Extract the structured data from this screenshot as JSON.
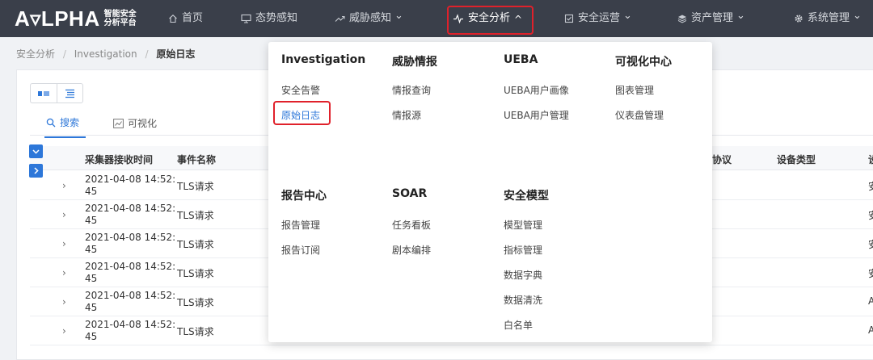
{
  "app": {
    "logo_text": "A▿LPHA",
    "logo_sub_1": "智能安全",
    "logo_sub_2": "分析平台"
  },
  "topnav": {
    "items": [
      {
        "label": "首页",
        "icon": "home-icon"
      },
      {
        "label": "态势感知",
        "icon": "monitor-icon"
      },
      {
        "label": "威胁感知",
        "icon": "trend-icon",
        "chevron": "down"
      },
      {
        "label": "安全分析",
        "icon": "pulse-icon",
        "chevron": "up",
        "active": true
      },
      {
        "label": "安全运营",
        "icon": "checkbox-icon",
        "chevron": "down"
      },
      {
        "label": "资产管理",
        "icon": "layers-icon",
        "chevron": "down"
      },
      {
        "label": "系统管理",
        "icon": "gear-icon",
        "chevron": "down"
      }
    ],
    "chev_down": "⌄",
    "chev_up": "^"
  },
  "breadcrumb": {
    "items": [
      "安全分析",
      "Investigation",
      "原始日志"
    ],
    "separator": "/"
  },
  "tabs": [
    {
      "label": "搜索",
      "active": true
    },
    {
      "label": "可视化",
      "active": false
    }
  ],
  "table": {
    "columns": [
      "采集器接收时间",
      "事件名称",
      "协议",
      "设备类型",
      "设"
    ],
    "rows": [
      {
        "time_line1": "2021-04-08 14:52:",
        "time_line2": "45",
        "event": "TLS请求",
        "right": "安"
      },
      {
        "time_line1": "2021-04-08 14:52:",
        "time_line2": "45",
        "event": "TLS请求",
        "right": "安"
      },
      {
        "time_line1": "2021-04-08 14:52:",
        "time_line2": "45",
        "event": "TLS请求",
        "right": "安"
      },
      {
        "time_line1": "2021-04-08 14:52:",
        "time_line2": "45",
        "event": "TLS请求",
        "right": "安"
      },
      {
        "time_line1": "2021-04-08 14:52:",
        "time_line2": "45",
        "event": "TLS请求",
        "right": "A"
      },
      {
        "time_line1": "2021-04-08 14:52:",
        "time_line2": "45",
        "event": "TLS请求",
        "right": "A"
      }
    ],
    "expand_chevron": "›"
  },
  "dropdown": {
    "sections": [
      {
        "title": "Investigation",
        "items": [
          "安全告警",
          "原始日志"
        ],
        "selected": "原始日志"
      },
      {
        "title": "威胁情报",
        "items": [
          "情报查询",
          "情报源"
        ]
      },
      {
        "title": "UEBA",
        "items": [
          "UEBA用户画像",
          "UEBA用户管理"
        ]
      },
      {
        "title": "可视化中心",
        "items": [
          "图表管理",
          "仪表盘管理"
        ]
      },
      {
        "title": "报告中心",
        "items": [
          "报告管理",
          "报告订阅"
        ]
      },
      {
        "title": "SOAR",
        "items": [
          "任务看板",
          "剧本编排"
        ]
      },
      {
        "title": "安全模型",
        "items": [
          "模型管理",
          "指标管理",
          "数据字典",
          "数据清洗",
          "白名单"
        ]
      }
    ]
  },
  "colors": {
    "nav_bg": "#3a3f4a",
    "accent": "#2d77d9",
    "highlight": "#e0212b"
  }
}
